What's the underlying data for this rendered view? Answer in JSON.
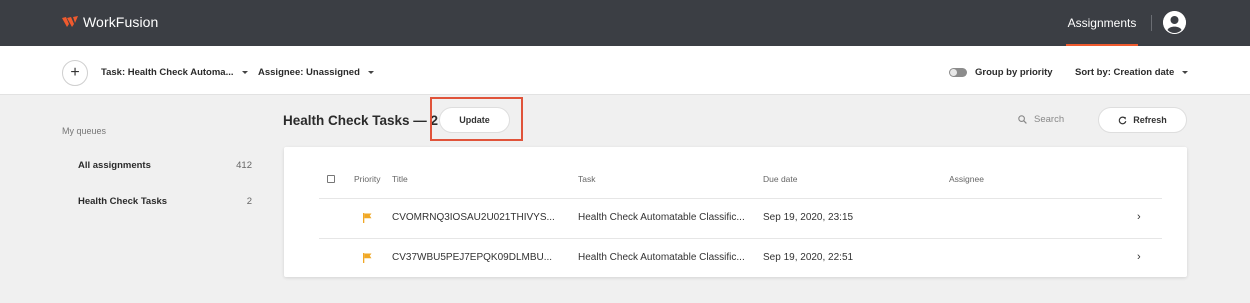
{
  "app": {
    "name": "WorkFusion",
    "brand_color": "#ef5a2e",
    "highlight_color": "#e0533a"
  },
  "topnav": {
    "assignments": "Assignments",
    "avatar_icon": "user-icon"
  },
  "filters": {
    "add_label": "+",
    "task": "Task: Health Check Automa...",
    "assignee": "Assignee: Unassigned",
    "group_by_priority": "Group by priority",
    "group_by_priority_on": false,
    "sort_by": "Sort by: Creation date"
  },
  "sidebar": {
    "title": "My queues",
    "queues": [
      {
        "label": "All assignments",
        "count": "412"
      },
      {
        "label": "Health Check Tasks",
        "count": "2"
      }
    ]
  },
  "main": {
    "title": "Health Check Tasks — 2",
    "update_label": "Update",
    "search_placeholder": "Search",
    "refresh_label": "Refresh"
  },
  "table": {
    "columns": {
      "priority": "Priority",
      "title": "Title",
      "task": "Task",
      "due_date": "Due date",
      "assignee": "Assignee"
    },
    "rows": [
      {
        "priority_icon": "flag-icon",
        "priority_color": "#f0a826",
        "title": "CVOMRNQ3IOSAU2U021THIVYS...",
        "task": "Health Check Automatable Classific...",
        "due_date": "Sep 19, 2020, 23:15",
        "assignee": ""
      },
      {
        "priority_icon": "flag-icon",
        "priority_color": "#f0a826",
        "title": "CV37WBU5PEJ7EPQK09DLMBU...",
        "task": "Health Check Automatable Classific...",
        "due_date": "Sep 19, 2020, 22:51",
        "assignee": ""
      }
    ]
  }
}
